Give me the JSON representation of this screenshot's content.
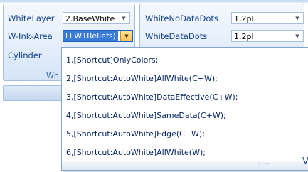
{
  "left_group": {
    "rows": [
      {
        "label": "WhiteLayer",
        "value": "2.BaseWhite"
      },
      {
        "label": "W-Ink-Area",
        "value": "l+W1Reliefs)"
      },
      {
        "label": "Cylinder",
        "value": ""
      }
    ],
    "caption": "Wh"
  },
  "right_group": {
    "rows": [
      {
        "label": "WhiteNoDataDots",
        "value": "1,2pl"
      },
      {
        "label": "WhiteDataDots",
        "value": "1,2pl"
      }
    ]
  },
  "dropdown": {
    "options": [
      "1,[Shortcut]OnlyColors;",
      "2,[Shortcut:AutoWhite]AllWhite(C+W);",
      "3,[Shortcut:AutoWhite]DataEffective(C+W);",
      "4,[Shortcut:AutoWhite]SameData(C+W);",
      "5,[Shortcut:AutoWhite]Edge(C+W);",
      "6,[Shortcut:AutoWhite]AllWhite(W);"
    ],
    "grip": "....",
    "edge_glyph": "V"
  }
}
